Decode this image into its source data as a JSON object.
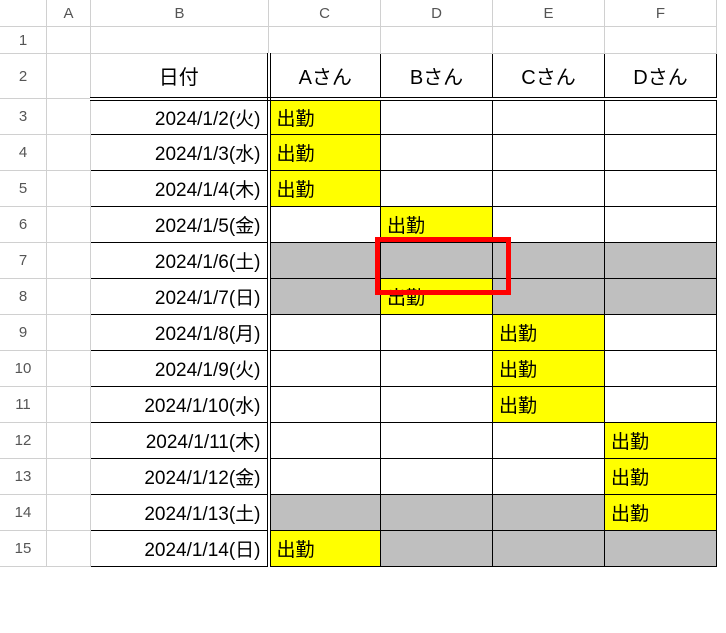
{
  "columns": [
    "A",
    "B",
    "C",
    "D",
    "E",
    "F"
  ],
  "row_numbers": [
    1,
    2,
    3,
    4,
    5,
    6,
    7,
    8,
    9,
    10,
    11,
    12,
    13,
    14,
    15
  ],
  "header": {
    "date": "日付",
    "cols": [
      "Aさん",
      "Bさん",
      "Cさん",
      "Dさん"
    ]
  },
  "attendance_label": "出勤",
  "rows": [
    {
      "date": "2024/1/2(火)",
      "gray": false,
      "work": [
        true,
        false,
        false,
        false
      ]
    },
    {
      "date": "2024/1/3(水)",
      "gray": false,
      "work": [
        true,
        false,
        false,
        false
      ]
    },
    {
      "date": "2024/1/4(木)",
      "gray": false,
      "work": [
        true,
        false,
        false,
        false
      ]
    },
    {
      "date": "2024/1/5(金)",
      "gray": false,
      "work": [
        false,
        true,
        false,
        false
      ]
    },
    {
      "date": "2024/1/6(土)",
      "gray": true,
      "work": [
        false,
        false,
        false,
        false
      ]
    },
    {
      "date": "2024/1/7(日)",
      "gray": true,
      "work": [
        false,
        true,
        false,
        false
      ]
    },
    {
      "date": "2024/1/8(月)",
      "gray": false,
      "work": [
        false,
        false,
        true,
        false
      ]
    },
    {
      "date": "2024/1/9(火)",
      "gray": false,
      "work": [
        false,
        false,
        true,
        false
      ]
    },
    {
      "date": "2024/1/10(水)",
      "gray": false,
      "work": [
        false,
        false,
        true,
        false
      ]
    },
    {
      "date": "2024/1/11(木)",
      "gray": false,
      "work": [
        false,
        false,
        false,
        true
      ]
    },
    {
      "date": "2024/1/12(金)",
      "gray": false,
      "work": [
        false,
        false,
        false,
        true
      ]
    },
    {
      "date": "2024/1/13(土)",
      "gray": true,
      "work": [
        false,
        false,
        false,
        true
      ]
    },
    {
      "date": "2024/1/14(日)",
      "gray": true,
      "work": [
        true,
        false,
        false,
        false
      ]
    }
  ],
  "colors": {
    "yellow": "#ffff00",
    "gray": "#bfbfbf",
    "gridline": "#d0d0d0",
    "border": "#000000",
    "highlight": "#ff0000"
  },
  "highlight_cell": "D7"
}
